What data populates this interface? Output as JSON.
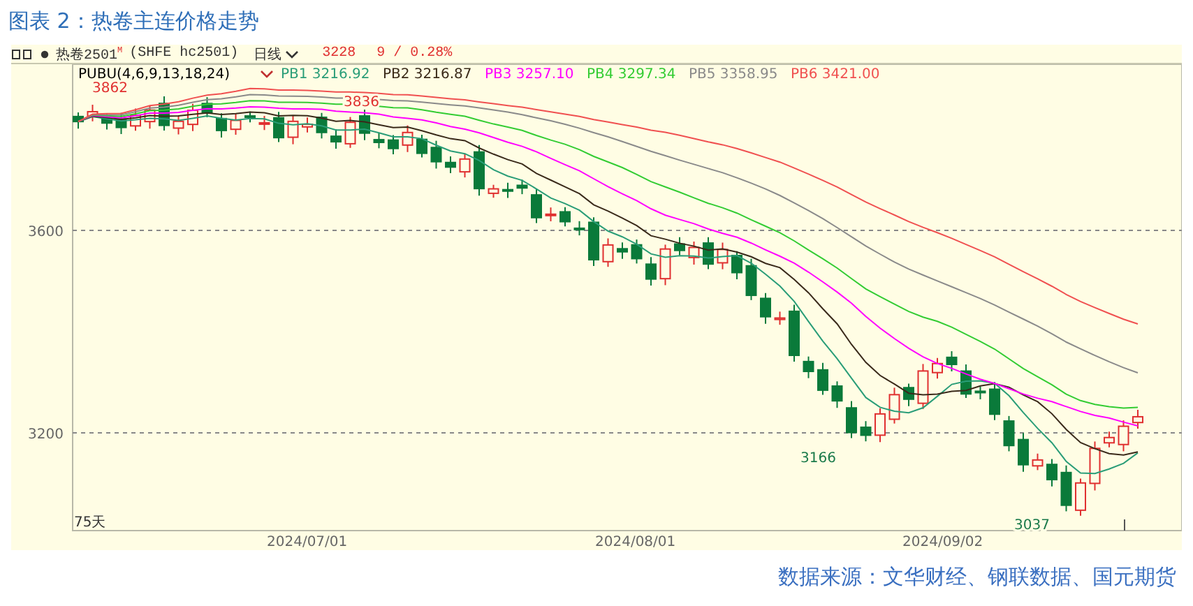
{
  "title": "图表 2：热卷主连价格走势",
  "toolbar": {
    "symbol": "热卷2501",
    "superscript": "M",
    "code": "(SHFE hc2501)",
    "period": "日线",
    "price": "3228",
    "change": "9 / 0.28%"
  },
  "indicator": {
    "name": "PUBU(4,6,9,13,18,24)",
    "values": [
      {
        "label": "PB1 3216.92",
        "color": "#2a9d78"
      },
      {
        "label": "PB2 3216.87",
        "color": "#3a2a1a"
      },
      {
        "label": "PB3 3257.10",
        "color": "#ff00ff"
      },
      {
        "label": "PB4 3297.34",
        "color": "#33cc33"
      },
      {
        "label": "PB5 3358.95",
        "color": "#8a8a8a"
      },
      {
        "label": "PB6 3421.00",
        "color": "#f05050"
      }
    ]
  },
  "y_axis": [
    "3600",
    "3200"
  ],
  "x_axis": [
    "2024/07/01",
    "2024/08/01",
    "2024/09/02"
  ],
  "annotations": [
    {
      "text": "3862",
      "kind": "high"
    },
    {
      "text": "3836",
      "kind": "high"
    },
    {
      "text": "3166",
      "kind": "low"
    },
    {
      "text": "3037",
      "kind": "low"
    }
  ],
  "day_count": "75天",
  "source": "数据来源：文华财经、钢联数据、国元期货"
}
